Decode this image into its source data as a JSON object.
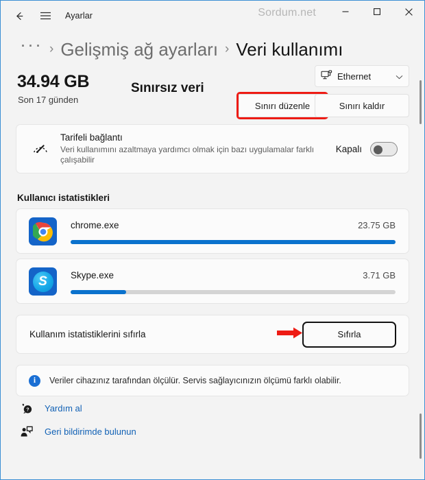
{
  "titlebar": {
    "back_icon": "back-arrow-icon",
    "menu_icon": "hamburger-menu-icon",
    "app_title": "Ayarlar",
    "watermark": "Sordum.net",
    "minimize_label": "−",
    "maximize_label": "□",
    "close_label": "✕"
  },
  "breadcrumb": {
    "overflow": "···",
    "separator": "›",
    "parent": "Gelişmiş ağ ayarları",
    "current": "Veri kullanımı"
  },
  "summary": {
    "total": "34.94 GB",
    "period": "Son 17 günden",
    "plan": "Sınırsız veri",
    "adapter": "Ethernet",
    "adapter_icon": "network-monitor-icon",
    "chevron_icon": "chevron-down-icon",
    "edit_limit_label": "Sınırı düzenle",
    "remove_limit_label": "Sınırı kaldır",
    "highlight_color": "#ee1b14"
  },
  "metered": {
    "icon": "speedometer-icon",
    "title": "Tarifeli bağlantı",
    "description": "Veri kullanımını azaltmaya yardımcı olmak için bazı uygulamalar farklı çalışabilir",
    "toggle_state_label": "Kapalı",
    "toggle_on": false
  },
  "usage": {
    "section_title": "Kullanıcı istatistikleri",
    "apps": [
      {
        "name": "chrome.exe",
        "size": "23.75 GB",
        "percent": 100,
        "icon": "chrome-icon"
      },
      {
        "name": "Skype.exe",
        "size": "3.71 GB",
        "percent": 17,
        "icon": "skype-icon"
      }
    ],
    "bar_color": "#0b72cd"
  },
  "reset": {
    "label": "Kullanım istatistiklerini sıfırla",
    "button_label": "Sıfırla",
    "arrow_icon": "red-arrow-icon",
    "arrow_color": "#ee1b14"
  },
  "info": {
    "icon": "info-icon",
    "symbol": "i",
    "text": "Veriler cihazınız tarafından ölçülür. Servis sağlayıcınızın ölçümü farklı olabilir."
  },
  "links": [
    {
      "label": "Yardım al",
      "icon": "help-question-icon"
    },
    {
      "label": "Geri bildirimde bulunun",
      "icon": "feedback-person-icon"
    }
  ],
  "chart_data": {
    "type": "bar",
    "title": "Kullanıcı istatistikleri",
    "categories": [
      "chrome.exe",
      "Skype.exe"
    ],
    "values": [
      23.75,
      3.71
    ],
    "value_labels": [
      "23.75 GB",
      "3.71 GB"
    ],
    "bar_percent": [
      100,
      17
    ],
    "ylabel": "GB",
    "xlabel": "",
    "ylim": [
      0,
      23.75
    ]
  }
}
